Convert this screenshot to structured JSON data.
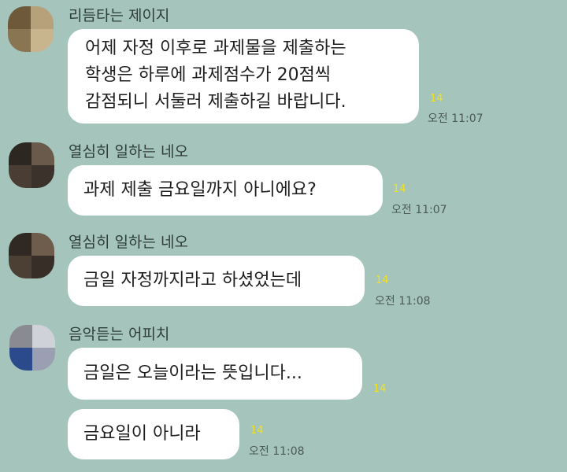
{
  "theme": {
    "background": "#a5c4bc",
    "bubble": "#ffffff",
    "unread_color": "#f4e11d"
  },
  "chat": {
    "groups": [
      {
        "sender": "리듬타는 제이지",
        "avatar_colors": [
          "#6e5a3a",
          "#b7a17a",
          "#8a7552",
          "#c8b58e"
        ],
        "messages": [
          {
            "lines": [
              "어제 자정 이후로 과제물을 제출하는",
              "학생은 하루에 과제점수가 20점씩",
              "감점되니 서둘러 제출하길 바랍니다."
            ],
            "unread": "14",
            "time": "오전 11:07"
          }
        ]
      },
      {
        "sender": "열심히 일하는 네오",
        "avatar_colors": [
          "#2d2721",
          "#6a5a4c",
          "#4a3d33",
          "#3a322b"
        ],
        "messages": [
          {
            "lines": [
              "과제 제출 금요일까지 아니에요?"
            ],
            "unread": "14",
            "time": "오전 11:07"
          }
        ]
      },
      {
        "sender": "열심히 일하는 네오",
        "avatar_colors": [
          "#302923",
          "#6e5c4c",
          "#4c4035",
          "#362e27"
        ],
        "messages": [
          {
            "lines": [
              "금일 자정까지라고 하셨었는데"
            ],
            "unread": "14",
            "time": "오전 11:08"
          }
        ]
      },
      {
        "sender": "음악듣는 어피치",
        "avatar_colors": [
          "#8a8a93",
          "#cfd2d8",
          "#2b4a8c",
          "#9aa0b2"
        ],
        "messages": [
          {
            "lines": [
              "금일은 오늘이라는 뜻입니다..."
            ],
            "unread": "14",
            "time": ""
          },
          {
            "lines": [
              "금요일이 아니라"
            ],
            "unread": "14",
            "time": "오전 11:08"
          }
        ]
      }
    ]
  }
}
